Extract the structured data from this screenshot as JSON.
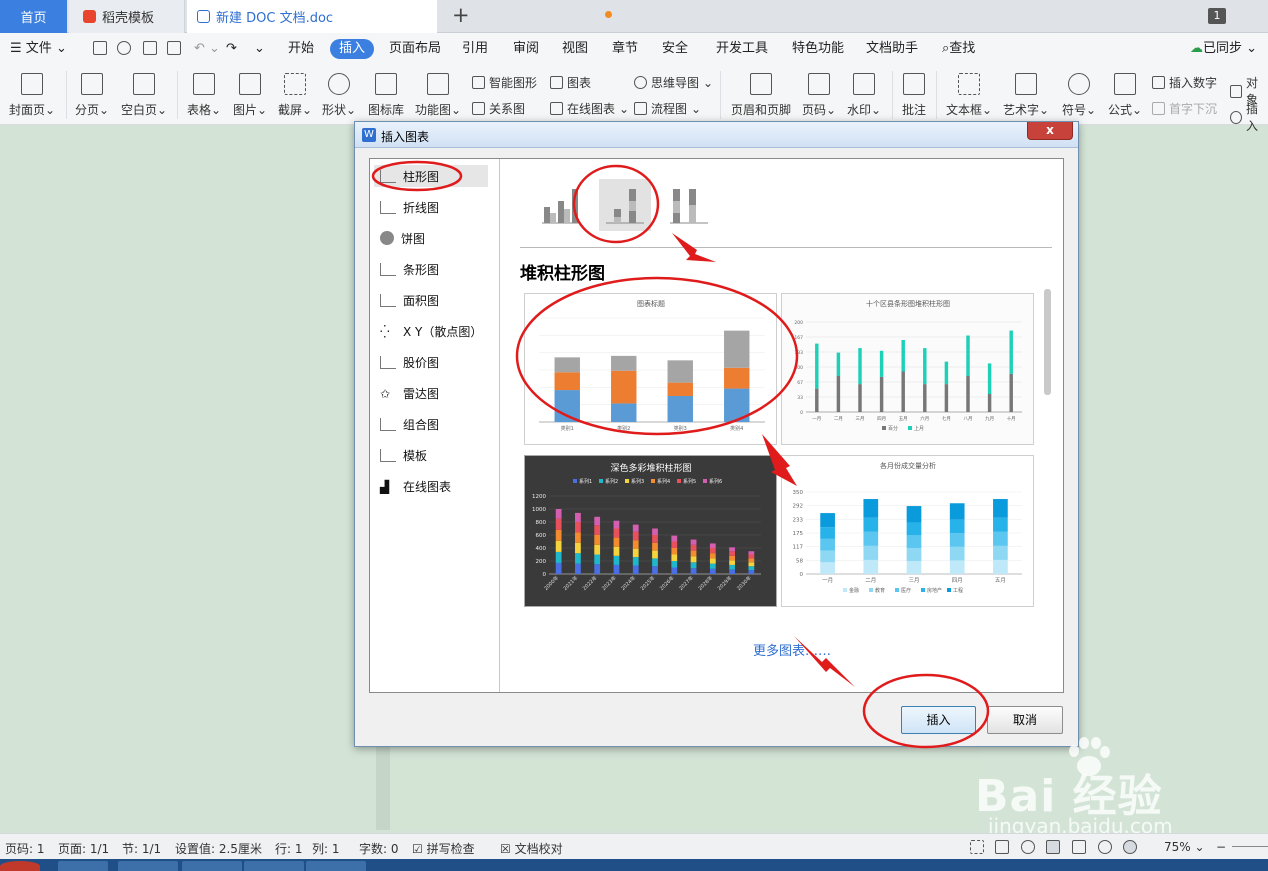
{
  "tabs": {
    "home": "首页",
    "template": "稻壳模板",
    "document": "新建 DOC 文档.doc",
    "window_count": "1"
  },
  "menu": {
    "file": "文件",
    "items": [
      "开始",
      "插入",
      "页面布局",
      "引用",
      "审阅",
      "视图",
      "章节",
      "安全",
      "开发工具",
      "特色功能",
      "文档助手"
    ],
    "search": "查找",
    "sync": "已同步"
  },
  "ribbon": {
    "cover": "封面页",
    "page_break": "分页",
    "blank_page": "空白页",
    "table": "表格",
    "picture": "图片",
    "screenshot": "截屏",
    "shape": "形状",
    "icon_lib": "图标库",
    "func_chart": "功能图",
    "smart_shape": "智能图形",
    "chart": "图表",
    "mindmap": "思维导图",
    "relation": "关系图",
    "online_chart": "在线图表",
    "flowchart": "流程图",
    "header_footer": "页眉和页脚",
    "page_num": "页码",
    "watermark": "水印",
    "comment": "批注",
    "textbox": "文本框",
    "art_text": "艺术字",
    "symbol": "符号",
    "formula": "公式",
    "insert_number": "插入数字",
    "object": "对象",
    "drop_cap": "首字下沉",
    "attach": "插入"
  },
  "dialog": {
    "title": "插入图表",
    "close": "x",
    "categories": [
      "柱形图",
      "折线图",
      "饼图",
      "条形图",
      "面积图",
      "X Y（散点图）",
      "股价图",
      "雷达图",
      "组合图",
      "模板",
      "在线图表"
    ],
    "selected_category": "柱形图",
    "subtype_heading": "堆积柱形图",
    "more_link": "更多图表……",
    "insert": "插入",
    "cancel": "取消",
    "thumbs": {
      "t1_title": "图表标题",
      "t2_title": "十个区县条形图堆积柱形图",
      "t3_title": "深色多彩堆积柱形图",
      "t4_title": "各月份成交量分析"
    }
  },
  "chart_data": [
    {
      "type": "bar",
      "stacked": true,
      "title": "图表标题",
      "categories": [
        "类别1",
        "类别2",
        "类别3",
        "类别4"
      ],
      "ylim": [
        0,
        14
      ],
      "series": [
        {
          "values": [
            4.3,
            2.5,
            3.5,
            4.5
          ],
          "color": "#5b9bd5"
        },
        {
          "values": [
            2.4,
            4.4,
            1.8,
            2.8
          ],
          "color": "#ed7d31"
        },
        {
          "values": [
            2.0,
            2.0,
            3.0,
            5.0
          ],
          "color": "#a5a5a5"
        }
      ]
    },
    {
      "type": "bar",
      "stacked": true,
      "title": "十个区县条形图堆积柱形图",
      "categories": [
        "一月",
        "二月",
        "三月",
        "四月",
        "五月",
        "六月",
        "七月",
        "八月",
        "九月",
        "十月"
      ],
      "ylim": [
        0,
        200
      ],
      "series": [
        {
          "name": "百分",
          "values": [
            52,
            80,
            62,
            78,
            90,
            62,
            62,
            80,
            40,
            85
          ],
          "color": "#777777"
        },
        {
          "name": "上月",
          "values": [
            100,
            52,
            80,
            58,
            70,
            80,
            50,
            90,
            68,
            96
          ],
          "color": "#1dd1b8"
        }
      ]
    },
    {
      "type": "bar",
      "stacked": true,
      "title": "深色多彩堆积柱形图",
      "categories": [
        "2000年",
        "2021年",
        "2022年",
        "2023年",
        "2024年",
        "2025年",
        "2026年",
        "2027年",
        "2028年",
        "2029年",
        "2030年"
      ],
      "ylim": [
        0,
        1200
      ],
      "series": [
        {
          "name": "系列1",
          "values": [
            170,
            160,
            150,
            140,
            130,
            120,
            100,
            90,
            80,
            70,
            60
          ],
          "color": "#4a6fe3"
        },
        {
          "name": "系列2",
          "values": [
            170,
            160,
            150,
            140,
            130,
            120,
            100,
            90,
            80,
            70,
            60
          ],
          "color": "#1fb7c9"
        },
        {
          "name": "系列3",
          "values": [
            170,
            160,
            150,
            140,
            130,
            120,
            100,
            90,
            80,
            70,
            60
          ],
          "color": "#f5d33f"
        },
        {
          "name": "系列4",
          "values": [
            170,
            160,
            150,
            140,
            130,
            120,
            100,
            90,
            80,
            70,
            60
          ],
          "color": "#f28c2e"
        },
        {
          "name": "系列5",
          "values": [
            170,
            160,
            150,
            140,
            130,
            120,
            100,
            90,
            80,
            70,
            60
          ],
          "color": "#e8505b"
        },
        {
          "name": "系列6",
          "values": [
            150,
            140,
            130,
            120,
            110,
            100,
            90,
            80,
            70,
            60,
            50
          ],
          "color": "#d45fb0"
        }
      ]
    },
    {
      "type": "bar",
      "stacked": true,
      "title": "各月份成交量分析",
      "categories": [
        "一月",
        "二月",
        "三月",
        "四月",
        "五月"
      ],
      "ylim": [
        0,
        350
      ],
      "series": [
        {
          "name": "金融",
          "values": [
            50,
            60,
            55,
            58,
            60
          ],
          "color": "#bfe9f8"
        },
        {
          "name": "教育",
          "values": [
            50,
            60,
            55,
            58,
            60
          ],
          "color": "#8fd8f4"
        },
        {
          "name": "医疗",
          "values": [
            50,
            60,
            55,
            58,
            60
          ],
          "color": "#5bc6ef"
        },
        {
          "name": "房地产",
          "values": [
            50,
            60,
            55,
            58,
            60
          ],
          "color": "#27b2ea"
        },
        {
          "name": "工程",
          "values": [
            60,
            80,
            70,
            70,
            80
          ],
          "color": "#0a9bdc"
        }
      ]
    }
  ],
  "status": {
    "page_code": "页码: 1",
    "page": "页面: 1/1",
    "section": "节: 1/1",
    "setting": "设置值: 2.5厘米",
    "row": "行: 1",
    "col": "列: 1",
    "words": "字数: 0",
    "spell": "拼写检查",
    "doc_check": "文档校对",
    "zoom": "75%"
  },
  "watermark": {
    "text": "Bai 经验",
    "url": "jingyan.baidu.com"
  },
  "colors": {
    "accent": "#3b7fe0",
    "annotation_red": "#e01b1b"
  }
}
